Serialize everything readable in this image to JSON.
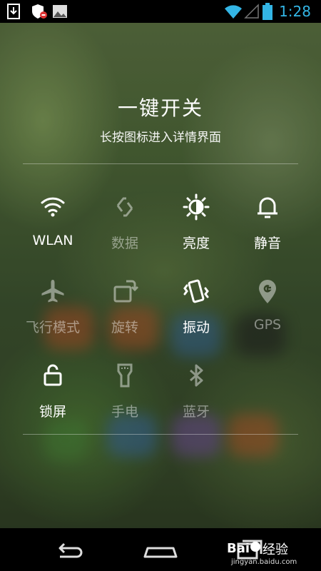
{
  "status_bar": {
    "time": "1:28",
    "left_icons": [
      "download-icon",
      "shield-alert-icon",
      "image-icon"
    ],
    "right_icons": [
      "wifi-icon",
      "signal-icon",
      "battery-icon"
    ],
    "accent_color": "#33b5e5"
  },
  "panel": {
    "title": "一键开关",
    "subtitle": "长按图标进入详情界面",
    "toggles": [
      {
        "label": "WLAN",
        "icon": "wifi-icon",
        "state": "on"
      },
      {
        "label": "数据",
        "icon": "data-sync-icon",
        "state": "off"
      },
      {
        "label": "亮度",
        "icon": "brightness-icon",
        "state": "on"
      },
      {
        "label": "静音",
        "icon": "bell-icon",
        "state": "on"
      },
      {
        "label": "飞行模式",
        "icon": "airplane-icon",
        "state": "off"
      },
      {
        "label": "旋转",
        "icon": "rotate-icon",
        "state": "off"
      },
      {
        "label": "振动",
        "icon": "vibrate-icon",
        "state": "on"
      },
      {
        "label": "GPS",
        "icon": "gps-icon",
        "state": "off"
      },
      {
        "label": "锁屏",
        "icon": "lock-icon",
        "state": "on"
      },
      {
        "label": "手电",
        "icon": "flashlight-icon",
        "state": "off"
      },
      {
        "label": "蓝牙",
        "icon": "bluetooth-icon",
        "state": "off"
      }
    ]
  },
  "nav_bar": {
    "buttons": [
      "back-icon",
      "home-icon",
      "recents-icon"
    ]
  },
  "watermark": {
    "text": "经验",
    "url": "jingyan.baidu.com"
  }
}
